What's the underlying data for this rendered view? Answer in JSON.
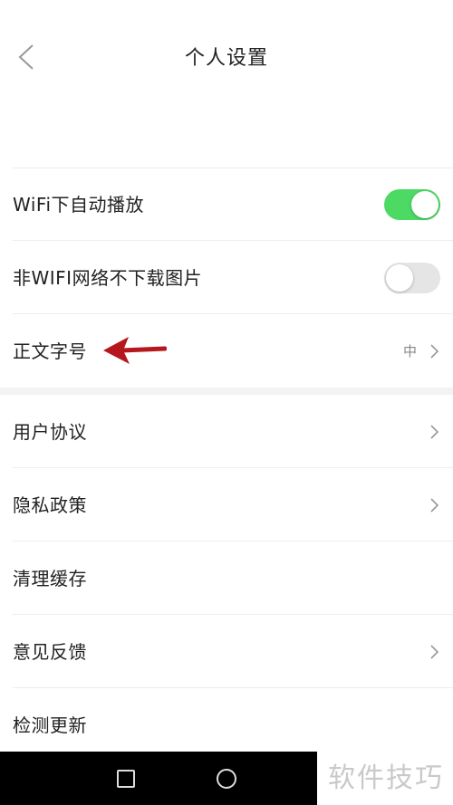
{
  "header": {
    "title": "个人设置"
  },
  "settings_group_1": [
    {
      "label": "WiFi下自动播放",
      "control": "toggle",
      "state": "on"
    },
    {
      "label": "非WIFI网络不下载图片",
      "control": "toggle",
      "state": "off"
    },
    {
      "label": "正文字号",
      "control": "chevron",
      "value": "中"
    }
  ],
  "settings_group_2": [
    {
      "label": "用户协议",
      "control": "chevron"
    },
    {
      "label": "隐私政策",
      "control": "chevron"
    },
    {
      "label": "清理缓存",
      "control": "none"
    },
    {
      "label": "意见反馈",
      "control": "chevron"
    },
    {
      "label": "检测更新",
      "control": "none"
    }
  ],
  "annotation": {
    "icon": "red-arrow-icon",
    "color": "#b5171c"
  },
  "colors": {
    "toggle_on": "#4cd964",
    "toggle_off": "#e5e5e5"
  },
  "navbar": {
    "icons": [
      "recent-apps-icon",
      "home-icon"
    ]
  },
  "watermark": {
    "text": "软件技巧"
  }
}
